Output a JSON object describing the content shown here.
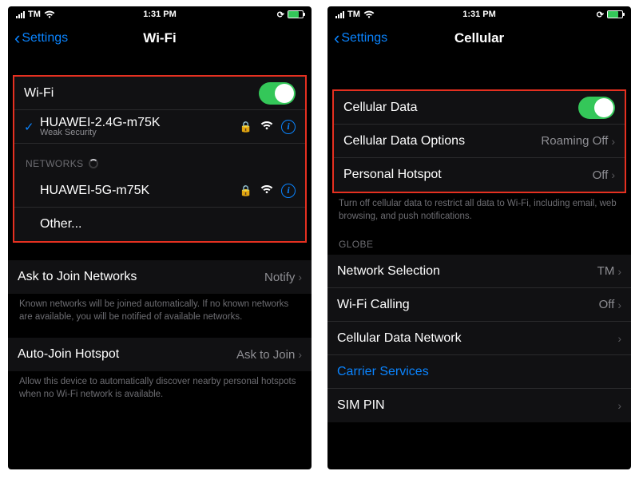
{
  "status": {
    "carrier": "TM",
    "time": "1:31 PM"
  },
  "left": {
    "back": "Settings",
    "title": "Wi-Fi",
    "wifi_label": "Wi-Fi",
    "connected": {
      "name": "HUAWEI-2.4G-m75K",
      "security": "Weak Security"
    },
    "networks_header": "NETWORKS",
    "available": {
      "name": "HUAWEI-5G-m75K"
    },
    "other": "Other...",
    "ask_join": {
      "label": "Ask to Join Networks",
      "value": "Notify"
    },
    "ask_join_note": "Known networks will be joined automatically. If no known networks are available, you will be notified of available networks.",
    "auto_hotspot": {
      "label": "Auto-Join Hotspot",
      "value": "Ask to Join"
    },
    "auto_hotspot_note": "Allow this device to automatically discover nearby personal hotspots when no Wi-Fi network is available."
  },
  "right": {
    "back": "Settings",
    "title": "Cellular",
    "cell_data": "Cellular Data",
    "cell_options": {
      "label": "Cellular Data Options",
      "value": "Roaming Off"
    },
    "hotspot": {
      "label": "Personal Hotspot",
      "value": "Off"
    },
    "cell_note": "Turn off cellular data to restrict all data to Wi-Fi, including email, web browsing, and push notifications.",
    "carrier_section": "GLOBE",
    "net_sel": {
      "label": "Network Selection",
      "value": "TM"
    },
    "wifi_calling": {
      "label": "Wi-Fi Calling",
      "value": "Off"
    },
    "cell_network": "Cellular Data Network",
    "carrier_services": "Carrier Services",
    "sim_pin": "SIM PIN"
  }
}
